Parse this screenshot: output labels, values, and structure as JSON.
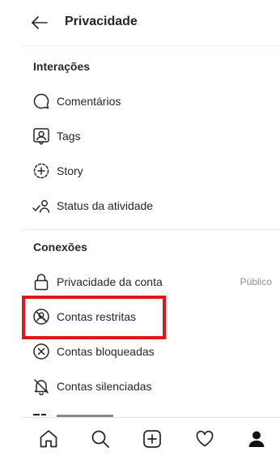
{
  "header": {
    "title": "Privacidade",
    "back_icon": "arrow-left-icon"
  },
  "sections": {
    "interacoes": "Interações",
    "conexoes": "Conexões"
  },
  "interacoes_items": [
    {
      "label": "Comentários",
      "icon": "comment-icon"
    },
    {
      "label": "Tags",
      "icon": "tag-user-icon"
    },
    {
      "label": "Story",
      "icon": "story-add-icon"
    },
    {
      "label": "Status da atividade",
      "icon": "activity-status-icon"
    }
  ],
  "conexoes_items": [
    {
      "label": "Privacidade da conta",
      "value": "Público",
      "icon": "lock-icon"
    },
    {
      "label": "Contas restritas",
      "icon": "restricted-icon"
    },
    {
      "label": "Contas bloqueadas",
      "icon": "blocked-icon"
    },
    {
      "label": "Contas silenciadas",
      "icon": "muted-bell-icon"
    }
  ],
  "bottom_nav": [
    "home-icon",
    "search-icon",
    "new-post-icon",
    "heart-icon",
    "profile-icon"
  ],
  "colors": {
    "highlight": "#e1151b",
    "text": "#262626",
    "muted": "#8e8e8e"
  }
}
